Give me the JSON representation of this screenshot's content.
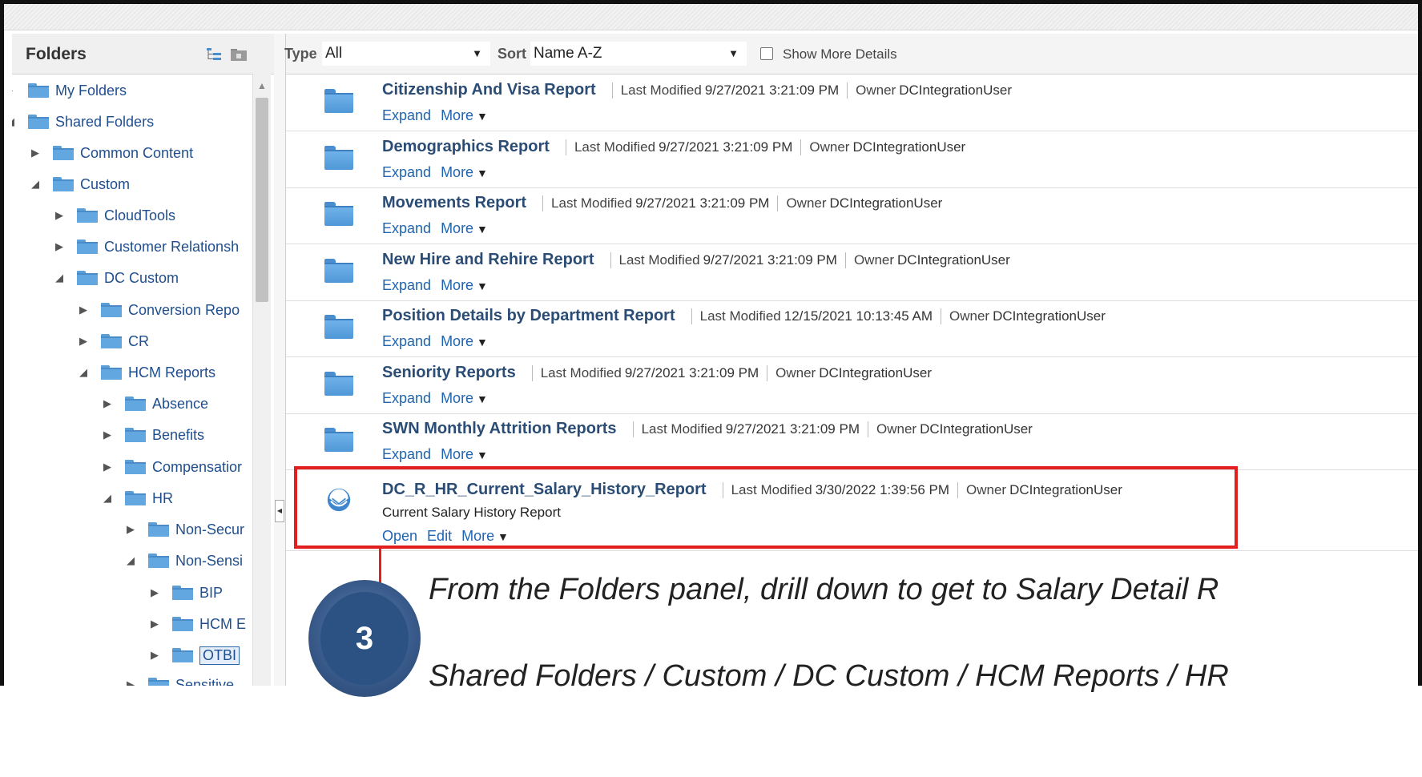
{
  "folders_panel": {
    "title": "Folders",
    "tree": [
      {
        "label": "My Folders",
        "depth": 0,
        "expanded": null
      },
      {
        "label": "Shared Folders",
        "depth": 0,
        "expanded": true
      },
      {
        "label": "Common Content",
        "depth": 1,
        "expanded": false
      },
      {
        "label": "Custom",
        "depth": 1,
        "expanded": true
      },
      {
        "label": "CloudTools",
        "depth": 2,
        "expanded": false
      },
      {
        "label": "Customer Relationsh",
        "depth": 2,
        "expanded": false
      },
      {
        "label": "DC Custom",
        "depth": 2,
        "expanded": true
      },
      {
        "label": "Conversion Repo",
        "depth": 3,
        "expanded": false
      },
      {
        "label": "CR",
        "depth": 3,
        "expanded": false
      },
      {
        "label": "HCM Reports",
        "depth": 3,
        "expanded": true
      },
      {
        "label": "Absence",
        "depth": 4,
        "expanded": false
      },
      {
        "label": "Benefits",
        "depth": 4,
        "expanded": false
      },
      {
        "label": "Compensatior",
        "depth": 4,
        "expanded": false
      },
      {
        "label": "HR",
        "depth": 4,
        "expanded": true
      },
      {
        "label": "Non-Secur",
        "depth": 5,
        "expanded": false
      },
      {
        "label": "Non-Sensi",
        "depth": 5,
        "expanded": true
      },
      {
        "label": "BIP",
        "depth": 6,
        "expanded": false
      },
      {
        "label": "HCM E",
        "depth": 6,
        "expanded": false
      },
      {
        "label": "OTBI",
        "depth": 6,
        "expanded": false,
        "selected": true
      },
      {
        "label": "Sensitive",
        "depth": 5,
        "expanded": false
      }
    ]
  },
  "toolbar": {
    "type_label": "Type",
    "type_value": "All",
    "sort_label": "Sort",
    "sort_value": "Name A-Z",
    "show_more_label": "Show More Details"
  },
  "items": [
    {
      "name": "Citizenship And Visa Report",
      "kind": "folder",
      "modified_label": "Last Modified",
      "modified": "9/27/2021 3:21:09 PM",
      "owner_label": "Owner",
      "owner": "DCIntegrationUser",
      "actions": [
        "Expand",
        "More"
      ]
    },
    {
      "name": "Demographics Report",
      "kind": "folder",
      "modified_label": "Last Modified",
      "modified": "9/27/2021 3:21:09 PM",
      "owner_label": "Owner",
      "owner": "DCIntegrationUser",
      "actions": [
        "Expand",
        "More"
      ]
    },
    {
      "name": "Movements Report",
      "kind": "folder",
      "modified_label": "Last Modified",
      "modified": "9/27/2021 3:21:09 PM",
      "owner_label": "Owner",
      "owner": "DCIntegrationUser",
      "actions": [
        "Expand",
        "More"
      ]
    },
    {
      "name": "New Hire and Rehire Report",
      "kind": "folder",
      "modified_label": "Last Modified",
      "modified": "9/27/2021 3:21:09 PM",
      "owner_label": "Owner",
      "owner": "DCIntegrationUser",
      "actions": [
        "Expand",
        "More"
      ]
    },
    {
      "name": "Position Details by Department Report",
      "kind": "folder",
      "modified_label": "Last Modified",
      "modified": "12/15/2021 10:13:45 AM",
      "owner_label": "Owner",
      "owner": "DCIntegrationUser",
      "actions": [
        "Expand",
        "More"
      ]
    },
    {
      "name": "Seniority Reports",
      "kind": "folder",
      "modified_label": "Last Modified",
      "modified": "9/27/2021 3:21:09 PM",
      "owner_label": "Owner",
      "owner": "DCIntegrationUser",
      "actions": [
        "Expand",
        "More"
      ]
    },
    {
      "name": "SWN Monthly Attrition Reports",
      "kind": "folder",
      "modified_label": "Last Modified",
      "modified": "9/27/2021 3:21:09 PM",
      "owner_label": "Owner",
      "owner": "DCIntegrationUser",
      "actions": [
        "Expand",
        "More"
      ]
    },
    {
      "name": "DC_R_HR_Current_Salary_History_Report",
      "kind": "analysis",
      "modified_label": "Last Modified",
      "modified": "3/30/2022 1:39:56 PM",
      "owner_label": "Owner",
      "owner": "DCIntegrationUser",
      "description": "Current Salary History Report",
      "actions": [
        "Open",
        "Edit",
        "More"
      ]
    }
  ],
  "callout": {
    "step": "3",
    "line1": "From the Folders panel, drill down to get to Salary Detail R",
    "line2": "Shared Folders / Custom / DC Custom / HCM Reports / HR",
    "highlight_color": "#e21e1e"
  },
  "icons": [
    "folder-icon",
    "analysis-icon",
    "expand-tree-icon",
    "new-folder-icon",
    "collapse-arrow-icon",
    "chevron-down-icon"
  ]
}
